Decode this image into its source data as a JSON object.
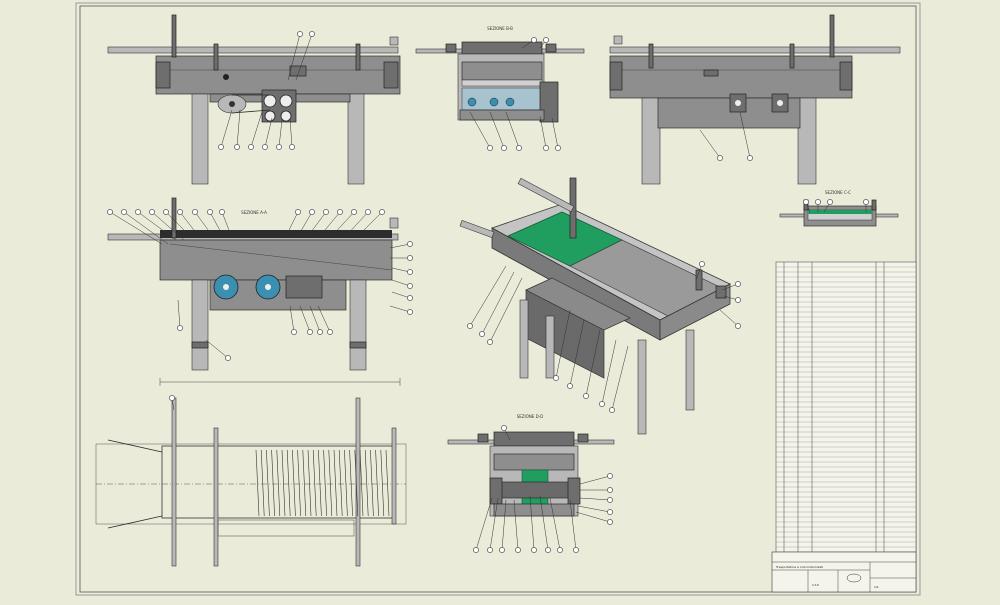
{
  "sheet": {
    "background": "#ebebd9",
    "paper": "#ebebd9",
    "accent_green": "#1f9e5f",
    "accent_teal": "#3b8fb0"
  },
  "views": {
    "front_top": {
      "name": "front-elevation"
    },
    "section_top_center": {
      "label": "SEZIONE B-B"
    },
    "rear_top": {
      "name": "rear-elevation"
    },
    "section_mid_left": {
      "label": "SEZIONE A-A"
    },
    "iso": {
      "name": "isometric-view"
    },
    "section_small_right": {
      "label": "SEZIONE C-C"
    },
    "plan_bottom": {
      "name": "plan-view"
    },
    "section_bottom_center": {
      "label": "SEZIONE D-D"
    }
  },
  "title_block": {
    "drawing_title": "Trasportatore a rulli motorizzati",
    "scale": "1:10",
    "sheet": "1/1"
  }
}
